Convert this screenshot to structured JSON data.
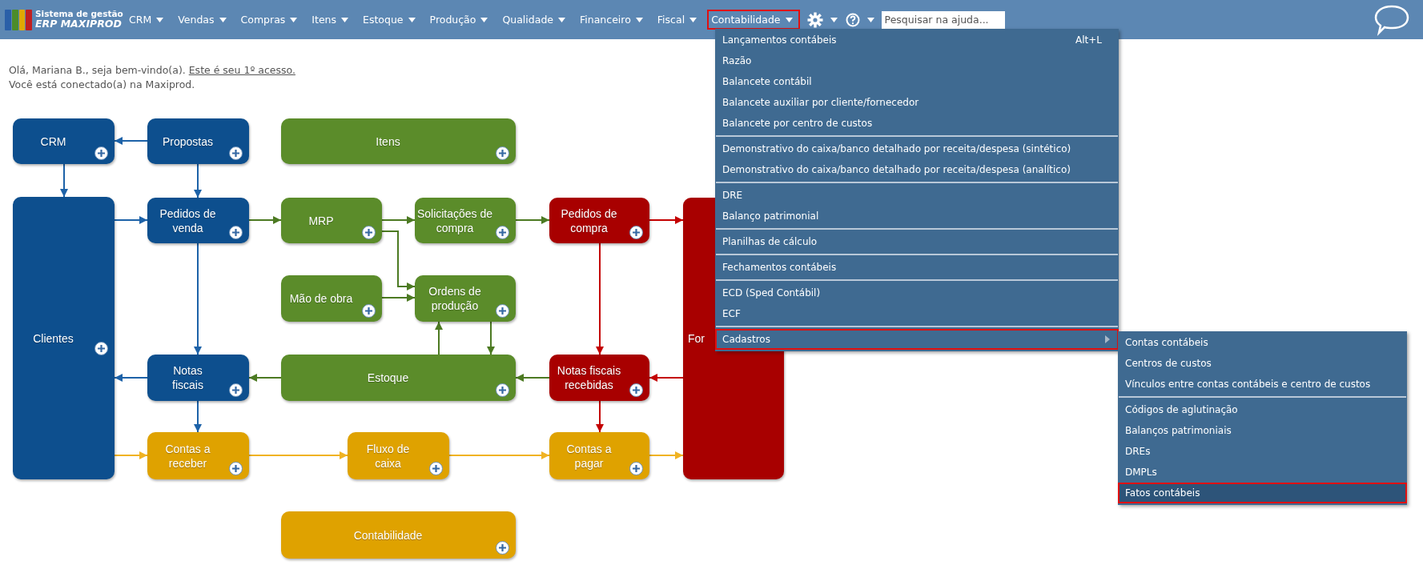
{
  "brand": {
    "line1": "Sistema de gestão",
    "line2": "ERP MAXIPROD"
  },
  "nav": {
    "items": [
      {
        "label": "CRM",
        "highlighted": false
      },
      {
        "label": "Vendas",
        "highlighted": false
      },
      {
        "label": "Compras",
        "highlighted": false
      },
      {
        "label": "Itens",
        "highlighted": false
      },
      {
        "label": "Estoque",
        "highlighted": false
      },
      {
        "label": "Produção",
        "highlighted": false
      },
      {
        "label": "Qualidade",
        "highlighted": false
      },
      {
        "label": "Financeiro",
        "highlighted": false
      },
      {
        "label": "Fiscal",
        "highlighted": false
      },
      {
        "label": "Contabilidade",
        "highlighted": true
      }
    ],
    "search": {
      "placeholder": "Pesquisar na ajuda..."
    }
  },
  "greeting": {
    "text": "Olá, Mariana B., seja bem-vindo(a).",
    "link": "Este é seu 1º acesso.",
    "line2": "Você está conectado(a) na Maxiprod."
  },
  "diagram": {
    "nodes": [
      {
        "label": "CRM",
        "color": "#0d4f8e"
      },
      {
        "label": "Propostas",
        "color": "#0d4f8e"
      },
      {
        "label": "Itens",
        "color": "#5b8c2a"
      },
      {
        "label": "Clientes",
        "color": "#0d4f8e"
      },
      {
        "label": "Pedidos de venda",
        "color": "#0d4f8e"
      },
      {
        "label": "MRP",
        "color": "#5b8c2a"
      },
      {
        "label": "Solicitações de compra",
        "color": "#5b8c2a"
      },
      {
        "label": "Pedidos de compra",
        "color": "#a80000"
      },
      {
        "label": "For",
        "color": "#a80000"
      },
      {
        "label": "Mão de obra",
        "color": "#5b8c2a"
      },
      {
        "label": "Ordens de produção",
        "color": "#5b8c2a"
      },
      {
        "label": "Notas fiscais",
        "color": "#0d4f8e"
      },
      {
        "label": "Estoque",
        "color": "#5b8c2a"
      },
      {
        "label": "Notas fiscais recebidas",
        "color": "#a80000"
      },
      {
        "label": "Contas a receber",
        "color": "#dfa200"
      },
      {
        "label": "Fluxo de caixa",
        "color": "#dfa200"
      },
      {
        "label": "Contas a pagar",
        "color": "#dfa200"
      },
      {
        "label": "Contabilidade",
        "color": "#dfa200"
      }
    ]
  },
  "menu": {
    "groups": [
      {
        "items": [
          {
            "label": "Lançamentos contábeis",
            "shortcut": "Alt+L",
            "kind": "command",
            "highlighted": false
          },
          {
            "label": "Razão",
            "kind": "command",
            "highlighted": false
          },
          {
            "label": "Balancete contábil",
            "kind": "command",
            "highlighted": false
          },
          {
            "label": "Balancete auxiliar por cliente/fornecedor",
            "kind": "command",
            "highlighted": false
          },
          {
            "label": "Balancete por centro de custos",
            "kind": "command",
            "highlighted": false
          }
        ]
      },
      {
        "items": [
          {
            "label": "Demonstrativo do caixa/banco detalhado por receita/despesa (sintético)",
            "kind": "command",
            "highlighted": false
          },
          {
            "label": "Demonstrativo do caixa/banco detalhado por receita/despesa (analítico)",
            "kind": "command",
            "highlighted": false
          }
        ]
      },
      {
        "items": [
          {
            "label": "DRE",
            "kind": "command",
            "highlighted": false
          },
          {
            "label": "Balanço patrimonial",
            "kind": "command",
            "highlighted": false
          }
        ]
      },
      {
        "items": [
          {
            "label": "Planilhas de cálculo",
            "kind": "command",
            "highlighted": false
          }
        ]
      },
      {
        "items": [
          {
            "label": "Fechamentos contábeis",
            "kind": "command",
            "highlighted": false
          }
        ]
      },
      {
        "items": [
          {
            "label": "ECD (Sped Contábil)",
            "kind": "command",
            "highlighted": false
          },
          {
            "label": "ECF",
            "kind": "command",
            "highlighted": false
          }
        ]
      },
      {
        "items": [
          {
            "label": "Cadastros",
            "kind": "submenu",
            "highlighted": true
          }
        ]
      }
    ]
  },
  "submenu": {
    "groups": [
      {
        "items": [
          {
            "label": "Contas contábeis",
            "highlighted": false
          },
          {
            "label": "Centros de custos",
            "highlighted": false
          },
          {
            "label": "Vínculos entre contas contábeis e centro de custos",
            "highlighted": false
          }
        ]
      },
      {
        "items": [
          {
            "label": "Códigos de aglutinação",
            "highlighted": false
          },
          {
            "label": "Balanços patrimoniais",
            "highlighted": false
          },
          {
            "label": "DREs",
            "highlighted": false
          },
          {
            "label": "DMPLs",
            "highlighted": false
          },
          {
            "label": "Fatos contábeis",
            "highlighted": true
          }
        ]
      }
    ]
  }
}
